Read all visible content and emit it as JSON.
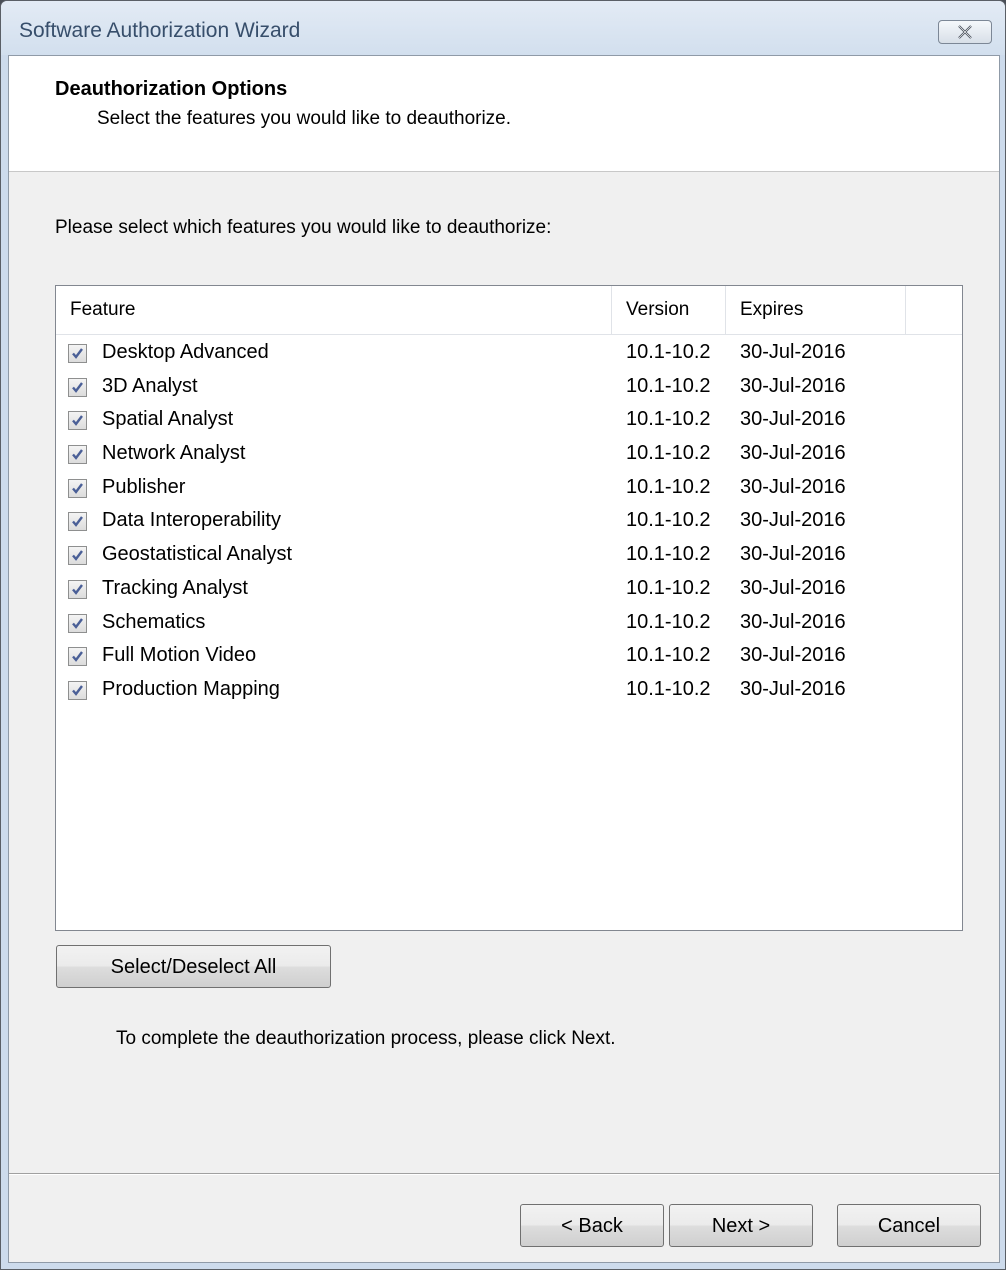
{
  "window": {
    "title": "Software Authorization Wizard",
    "close_icon": "close-icon"
  },
  "header": {
    "title": "Deauthorization Options",
    "subtitle": "Select the features you would like to deauthorize."
  },
  "prompt": "Please select which features you would like to deauthorize:",
  "table": {
    "columns": [
      "Feature",
      "Version",
      "Expires"
    ],
    "rows": [
      {
        "feature": "Desktop Advanced",
        "version": "10.1-10.2",
        "expires": "30-Jul-2016",
        "checked": true
      },
      {
        "feature": "3D Analyst",
        "version": "10.1-10.2",
        "expires": "30-Jul-2016",
        "checked": true
      },
      {
        "feature": "Spatial Analyst",
        "version": "10.1-10.2",
        "expires": "30-Jul-2016",
        "checked": true
      },
      {
        "feature": "Network Analyst",
        "version": "10.1-10.2",
        "expires": "30-Jul-2016",
        "checked": true
      },
      {
        "feature": "Publisher",
        "version": "10.1-10.2",
        "expires": "30-Jul-2016",
        "checked": true
      },
      {
        "feature": "Data Interoperability",
        "version": "10.1-10.2",
        "expires": "30-Jul-2016",
        "checked": true
      },
      {
        "feature": "Geostatistical Analyst",
        "version": "10.1-10.2",
        "expires": "30-Jul-2016",
        "checked": true
      },
      {
        "feature": "Tracking Analyst",
        "version": "10.1-10.2",
        "expires": "30-Jul-2016",
        "checked": true
      },
      {
        "feature": "Schematics",
        "version": "10.1-10.2",
        "expires": "30-Jul-2016",
        "checked": true
      },
      {
        "feature": "Full Motion Video",
        "version": "10.1-10.2",
        "expires": "30-Jul-2016",
        "checked": true
      },
      {
        "feature": "Production Mapping",
        "version": "10.1-10.2",
        "expires": "30-Jul-2016",
        "checked": true
      }
    ]
  },
  "buttons": {
    "select_all": "Select/Deselect All",
    "back": "< Back",
    "next": "Next >",
    "cancel": "Cancel"
  },
  "note": "To complete the deauthorization process, please click Next.",
  "colors": {
    "title_text": "#374e6b",
    "frame": "#cddbec",
    "checkmark": "#4a5f97"
  }
}
